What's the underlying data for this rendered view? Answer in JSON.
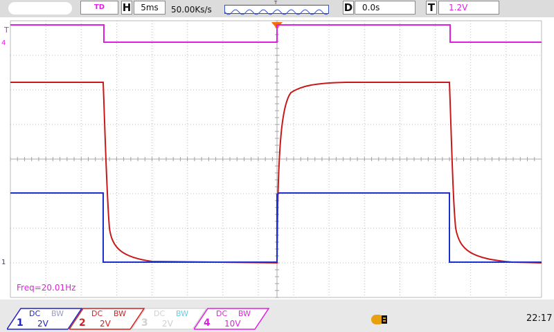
{
  "topbar": {
    "mode": "TD",
    "timebase_label": "H",
    "timebase": "5ms",
    "sample_rate": "50.00Ks/s",
    "mini_trigger_mark": "T",
    "delay_label": "D",
    "delay": "0.0s",
    "trigger_label": "T",
    "trigger_level": "1.2V"
  },
  "screen": {
    "trigger_marker": "T",
    "ch4_marker": "4",
    "ch1_marker": "1",
    "measurement": "Freq=20.01Hz"
  },
  "channels": [
    {
      "number": "1",
      "coupling": "DC",
      "bw": "BW",
      "scale": "2V",
      "color": "#2020c0"
    },
    {
      "number": "2",
      "coupling": "DC",
      "bw": "BW",
      "scale": "2V",
      "color": "#d02020"
    },
    {
      "number": "3",
      "coupling": "DC",
      "bw": "BW",
      "scale": "2V",
      "color": "#cfcfcf"
    },
    {
      "number": "4",
      "coupling": "DC",
      "bw": "BW",
      "scale": "10V",
      "color": "#e020e0"
    }
  ],
  "status": {
    "usb_icon": "usb-icon",
    "clock": "22:17"
  },
  "colors": {
    "ch1": "#1a2fd0",
    "ch2": "#d01818",
    "ch4": "#e020e0",
    "grid": "#bdbdbd",
    "screen": "#ffffff"
  }
}
